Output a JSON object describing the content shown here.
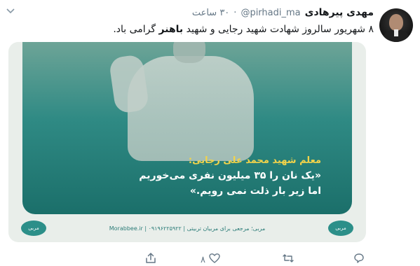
{
  "tweet": {
    "author_name": "مهدی پیرهادی",
    "handle": "@pirhadi_ma",
    "separator": "·",
    "time": "۳۰ ساعت",
    "text_part1": "۸ شهریور سالروز شهادت شهید رجایی و شهید ",
    "text_bold": "باهنر",
    "text_part2": " گرامی باد."
  },
  "media": {
    "poster_title": "معلم شهید محمد علی رجایی:",
    "poster_quote_line1": "«یک نان را ۳۵ میلیون نفری می‌خوریم",
    "poster_quote_line2": "اما زیر بار ذلت نمی رویم.»",
    "footer_text": "مربی؛ مرجعی برای مربیان تربیتی | Morabbee.ir | ۰۹۱۹۶۲۲۵۹۲۲",
    "badge_left": "مربی",
    "badge_right": "مربی"
  },
  "actions": {
    "like_count": "۸"
  },
  "icons": {
    "chevron": "chevron-down-icon",
    "share": "share-icon",
    "like": "heart-icon",
    "retweet": "retweet-icon",
    "reply": "reply-icon"
  },
  "colors": {
    "poster_teal": "#2f8a84",
    "poster_title_yellow": "#f2d34a",
    "muted_text": "#657786"
  }
}
